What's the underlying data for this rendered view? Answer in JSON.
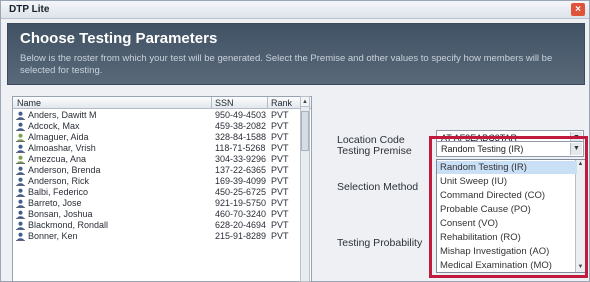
{
  "window": {
    "title": "DTP Lite",
    "close_glyph": "×"
  },
  "header": {
    "title": "Choose Testing Parameters",
    "description": "Below is the roster from which your test will be generated. Select the Premise and other values to specify how members will be selected for testing."
  },
  "roster": {
    "columns": [
      "Name",
      "SSN",
      "Rank"
    ],
    "rows": [
      {
        "name": "Anders, Dawitt M",
        "ssn": "950-49-4503",
        "rank": "PVT",
        "icon": "person-icon"
      },
      {
        "name": "Adcock, Max",
        "ssn": "459-38-2082",
        "rank": "PVT",
        "icon": "person-icon"
      },
      {
        "name": "Almaguer, Aida",
        "ssn": "328-84-1588",
        "rank": "PVT",
        "icon": "person-icon-green"
      },
      {
        "name": "Almoashar, Vrish",
        "ssn": "118-71-5268",
        "rank": "PVT",
        "icon": "person-icon"
      },
      {
        "name": "Amezcua, Ana",
        "ssn": "304-33-9296",
        "rank": "PVT",
        "icon": "person-icon-green"
      },
      {
        "name": "Anderson, Brenda",
        "ssn": "137-22-6365",
        "rank": "PVT",
        "icon": "person-icon"
      },
      {
        "name": "Anderson, Rick",
        "ssn": "169-39-4099",
        "rank": "PVT",
        "icon": "person-icon"
      },
      {
        "name": "Balbi, Federico",
        "ssn": "450-25-6725",
        "rank": "PVT",
        "icon": "person-icon"
      },
      {
        "name": "Barreto, Jose",
        "ssn": "921-19-5750",
        "rank": "PVT",
        "icon": "person-icon"
      },
      {
        "name": "Bonsan, Joshua",
        "ssn": "460-70-3240",
        "rank": "PVT",
        "icon": "person-icon"
      },
      {
        "name": "Blackmond, Rondall",
        "ssn": "628-20-4694",
        "rank": "PVT",
        "icon": "person-icon"
      },
      {
        "name": "Bonner, Ken",
        "ssn": "215-91-8289",
        "rank": "PVT",
        "icon": "person-icon"
      }
    ]
  },
  "form": {
    "location_code_label": "Location Code",
    "location_code_value": "AT AF3EABC3TAR",
    "testing_premise_label": "Testing Premise",
    "testing_premise_value": "Random Testing (IR)",
    "selection_method_label": "Selection Method",
    "testing_probability_label": "Testing Probability"
  },
  "premise_options": [
    "Random Testing (IR)",
    "Unit Sweep (IU)",
    "Command Directed (CO)",
    "Probable Cause (PO)",
    "Consent (VO)",
    "Rehabilitation (RO)",
    "Mishap Investigation (AO)",
    "Medical Examination (MO)"
  ],
  "premise_selected_index": 0,
  "colors": {
    "header_bg": "#4a5b6d",
    "highlight_border": "#c11a3f",
    "selected_option": "#c9dff6"
  }
}
